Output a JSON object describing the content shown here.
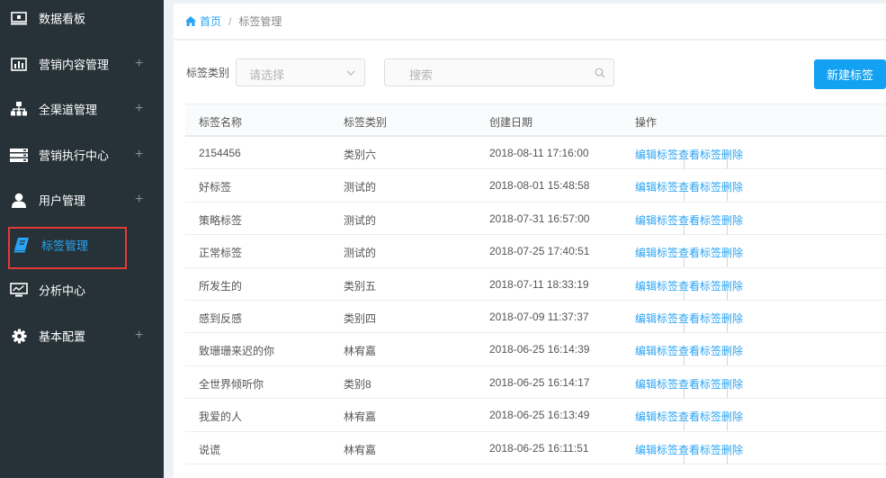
{
  "sidebar": {
    "items": [
      {
        "label": "数据看板",
        "icon": "dashboard-monitor-icon",
        "expandable": false
      },
      {
        "label": "营销内容管理",
        "icon": "bar-chart-icon",
        "expandable": true
      },
      {
        "label": "全渠道管理",
        "icon": "sitemap-icon",
        "expandable": true
      },
      {
        "label": "营销执行中心",
        "icon": "server-stack-icon",
        "expandable": true
      },
      {
        "label": "用户管理",
        "icon": "user-icon",
        "expandable": true
      },
      {
        "label": "标签管理",
        "icon": "book-icon",
        "expandable": false,
        "active": true
      },
      {
        "label": "分析中心",
        "icon": "analytics-monitor-icon",
        "expandable": false
      },
      {
        "label": "基本配置",
        "icon": "gear-icon",
        "expandable": true
      }
    ],
    "plus_symbol": "+"
  },
  "breadcrumb": {
    "home": "首页",
    "separator": "/",
    "current": "标签管理"
  },
  "filter": {
    "label": "标签类别",
    "select_placeholder": "请选择",
    "search_placeholder": "搜索",
    "new_button": "新建标签"
  },
  "table": {
    "columns": [
      "标签名称",
      "标签类别",
      "创建日期",
      "操作"
    ],
    "actions": [
      "编辑标签",
      "查看标签",
      "删除"
    ],
    "action_separator": "|",
    "rows": [
      {
        "name": "2154456",
        "category": "类别六",
        "date": "2018-08-11 17:16:00"
      },
      {
        "name": "好标签",
        "category": "测试的",
        "date": "2018-08-01 15:48:58"
      },
      {
        "name": "策略标签",
        "category": "测试的",
        "date": "2018-07-31 16:57:00"
      },
      {
        "name": "正常标签",
        "category": "测试的",
        "date": "2018-07-25 17:40:51"
      },
      {
        "name": "所发生的",
        "category": "类别五",
        "date": "2018-07-11 18:33:19"
      },
      {
        "name": "感到反感",
        "category": "类别四",
        "date": "2018-07-09 11:37:37"
      },
      {
        "name": "致珊珊来迟的你",
        "category": "林宥嘉",
        "date": "2018-06-25 16:14:39"
      },
      {
        "name": "全世界倾听你",
        "category": "类别8",
        "date": "2018-06-25 16:14:17"
      },
      {
        "name": "我爱的人",
        "category": "林宥嘉",
        "date": "2018-06-25 16:13:49"
      },
      {
        "name": "说谎",
        "category": "林宥嘉",
        "date": "2018-06-25 16:11:51"
      }
    ]
  },
  "colors": {
    "sidebar_bg": "#263238",
    "accent": "#2aa4f4",
    "button_bg": "#13a1f2",
    "highlight_border": "#e53935"
  }
}
